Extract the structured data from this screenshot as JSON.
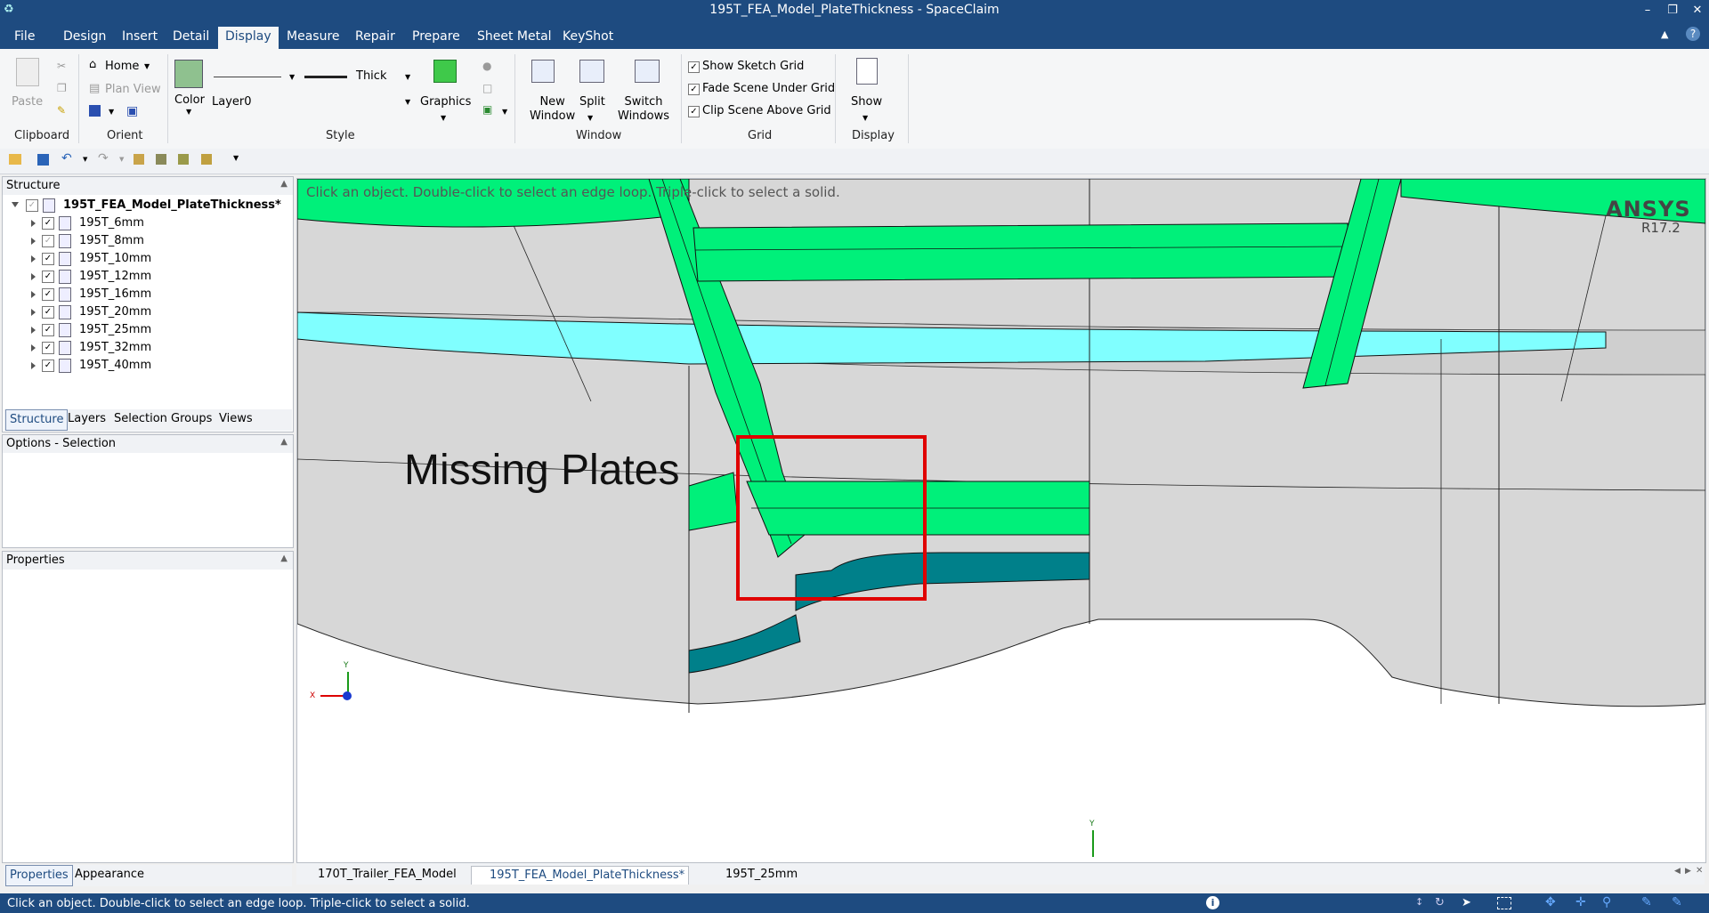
{
  "window": {
    "title": "195T_FEA_Model_PlateThickness - SpaceClaim",
    "controls": {
      "minimize": "–",
      "restore": "❐",
      "close": "✕"
    }
  },
  "ribbon": {
    "tabs": [
      "File",
      "Design",
      "Insert",
      "Detail",
      "Display",
      "Measure",
      "Repair",
      "Prepare",
      "Sheet Metal",
      "KeyShot"
    ],
    "active_tab": "Display",
    "help": "?",
    "clipboard": {
      "paste": "Paste",
      "label": "Clipboard"
    },
    "orient": {
      "home": "Home",
      "plan_view": "Plan View",
      "label": "Orient"
    },
    "style": {
      "color": "Color",
      "layer": "Layer0",
      "thickness": "Thick",
      "graphics": "Graphics",
      "label": "Style"
    },
    "window": {
      "new_window": [
        "New",
        "Window"
      ],
      "split": "Split",
      "switch_windows": [
        "Switch",
        "Windows"
      ],
      "label": "Window"
    },
    "grid": {
      "items": [
        {
          "label": "Show Sketch Grid",
          "checked": true
        },
        {
          "label": "Fade Scene Under Grid",
          "checked": true
        },
        {
          "label": "Clip Scene Above Grid",
          "checked": true
        }
      ],
      "label": "Grid"
    },
    "display": {
      "show": "Show",
      "label": "Display"
    }
  },
  "structure_panel": {
    "title": "Structure",
    "root": "195T_FEA_Model_PlateThickness*",
    "items": [
      "195T_6mm",
      "195T_8mm",
      "195T_10mm",
      "195T_12mm",
      "195T_16mm",
      "195T_20mm",
      "195T_25mm",
      "195T_32mm",
      "195T_40mm"
    ],
    "tabs": [
      "Structure",
      "Layers",
      "Selection",
      "Groups",
      "Views"
    ]
  },
  "options_panel": {
    "title": "Options - Selection"
  },
  "properties_panel": {
    "title": "Properties",
    "tabs": [
      "Properties",
      "Appearance"
    ]
  },
  "viewport": {
    "hint": "Click an object. Double-click to select an edge loop. Triple-click to select a solid.",
    "logo": "ANSYS",
    "version": "R17.2",
    "annotation": "Missing Plates",
    "triad": {
      "x": "X",
      "y": "Y"
    },
    "axis_y": "Y"
  },
  "doc_tabs": [
    {
      "label": "170T_Trailer_FEA_Model",
      "active": false
    },
    {
      "label": "195T_FEA_Model_PlateThickness*",
      "active": true
    },
    {
      "label": "195T_25mm",
      "active": false
    }
  ],
  "status": {
    "text": "Click an object. Double-click to select an edge loop. Triple-click to select a solid."
  },
  "colors": {
    "accent": "#1e4b80",
    "plate_green": "#00f07a",
    "plate_cyan": "#80ffff",
    "plate_teal": "#00808a",
    "highlight_red": "#e00000"
  }
}
